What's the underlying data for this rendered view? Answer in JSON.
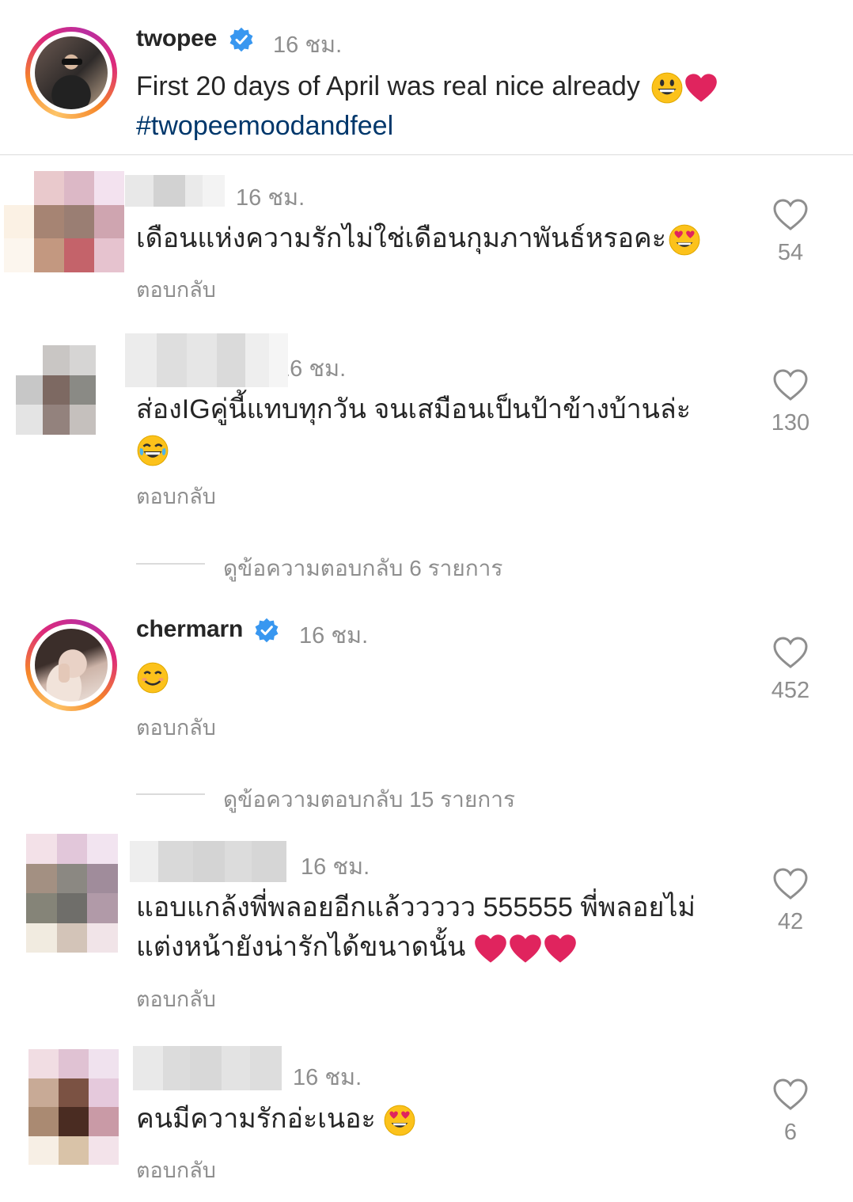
{
  "post": {
    "username": "twopee",
    "time": "16 ชม.",
    "caption": "First 20 days of April was real nice already",
    "hashtag": "#twopeemoodandfeel"
  },
  "comments": [
    {
      "time": "16 ชม.",
      "text": "เดือนแห่งความรักไม่ใช่เดือนกุมภาพันธ์หรอคะ",
      "reply": "ตอบกลับ",
      "likes": "54"
    },
    {
      "time": "16 ชม.",
      "text": "ส่องIGคู่นี้แทบทุกวัน จนเสมือนเป็นป้าข้างบ้านล่ะ",
      "reply": "ตอบกลับ",
      "likes": "130",
      "view_replies": "ดูข้อความตอบกลับ 6 รายการ"
    },
    {
      "username": "chermarn",
      "time": "16 ชม.",
      "reply": "ตอบกลับ",
      "likes": "452",
      "view_replies": "ดูข้อความตอบกลับ 15 รายการ"
    },
    {
      "time": "16 ชม.",
      "text_line1": "แอบแกล้งพี่พลอยอีกแล้ววววว 555555 พี่พลอยไม่",
      "text_line2": "แต่งหน้ายังน่ารักได้ขนาดนั้น",
      "reply": "ตอบกลับ",
      "likes": "42"
    },
    {
      "time": "16 ชม.",
      "text": "คนมีความรักอ่ะเนอะ",
      "reply": "ตอบกลับ",
      "likes": "6"
    }
  ],
  "icons": {
    "verified": "verified-badge-icon",
    "like": "heart-outline-icon",
    "emojis": [
      "grinning-face-icon",
      "red-heart-icon",
      "heart-eyes-icon",
      "tears-of-joy-icon",
      "smiling-face-icon"
    ]
  },
  "colors": {
    "verified": "#3897f0",
    "hashtag": "#00376b",
    "secondary_text": "#8e8e8e",
    "heart": "#e0245e"
  }
}
